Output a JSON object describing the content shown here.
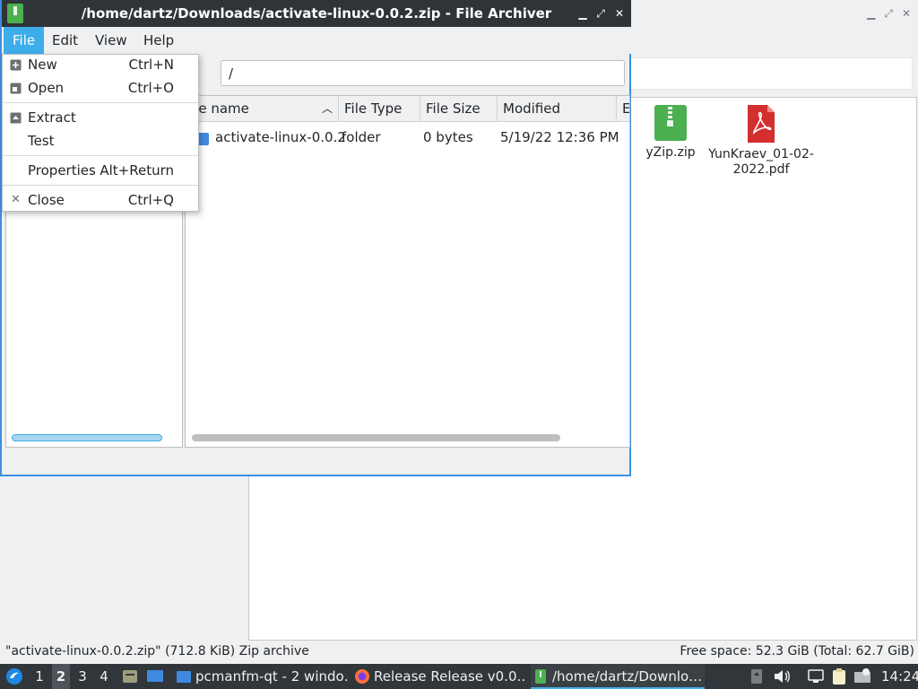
{
  "background_window": {
    "desktop_items": [
      {
        "label": "yZip.zip"
      },
      {
        "label": "YunKraev_01-02-2022.pdf"
      }
    ],
    "status_left": "\"activate-linux-0.0.2.zip\" (712.8 KiB) Zip archive",
    "status_right": "Free space: 52.3 GiB (Total: 62.7 GiB)"
  },
  "archiver": {
    "title": "/home/dartz/Downloads/activate-linux-0.0.2.zip - File Archiver",
    "menubar": [
      "File",
      "Edit",
      "View",
      "Help"
    ],
    "path": "/",
    "columns": [
      "ile name",
      "File Type",
      "File Size",
      "Modified",
      "E"
    ],
    "rows": [
      {
        "name": "activate-linux-0.0.2",
        "type": "folder",
        "size": "0 bytes",
        "modified": "5/19/22 12:36 PM"
      }
    ]
  },
  "file_menu": {
    "items": [
      {
        "label": "New",
        "shortcut": "Ctrl+N",
        "icon": "new-icon"
      },
      {
        "label": "Open",
        "shortcut": "Ctrl+O",
        "icon": "open-icon"
      },
      {
        "label": "Extract",
        "shortcut": "",
        "icon": "extract-icon"
      },
      {
        "label": "Test",
        "shortcut": "",
        "icon": ""
      },
      {
        "label": "Properties",
        "shortcut": "Alt+Return",
        "icon": ""
      },
      {
        "label": "Close",
        "shortcut": "Ctrl+Q",
        "icon": "close-icon"
      }
    ]
  },
  "taskbar": {
    "desktops": [
      "1",
      "2",
      "3",
      "4"
    ],
    "active_desktop": "2",
    "tasks": [
      {
        "label": "pcmanfm-qt - 2 windo…",
        "icon": "folder-icon"
      },
      {
        "label": "Release Release v0.0.…",
        "icon": "firefox-icon"
      },
      {
        "label": "/home/dartz/Downlo…",
        "icon": "archive-icon"
      }
    ],
    "clock": "14:24"
  },
  "colors": {
    "accent": "#3daee9",
    "titlebar": "#2f3439",
    "taskbar": "#31363b",
    "zip_green": "#4caf50",
    "pdf_red": "#d32f2f"
  }
}
